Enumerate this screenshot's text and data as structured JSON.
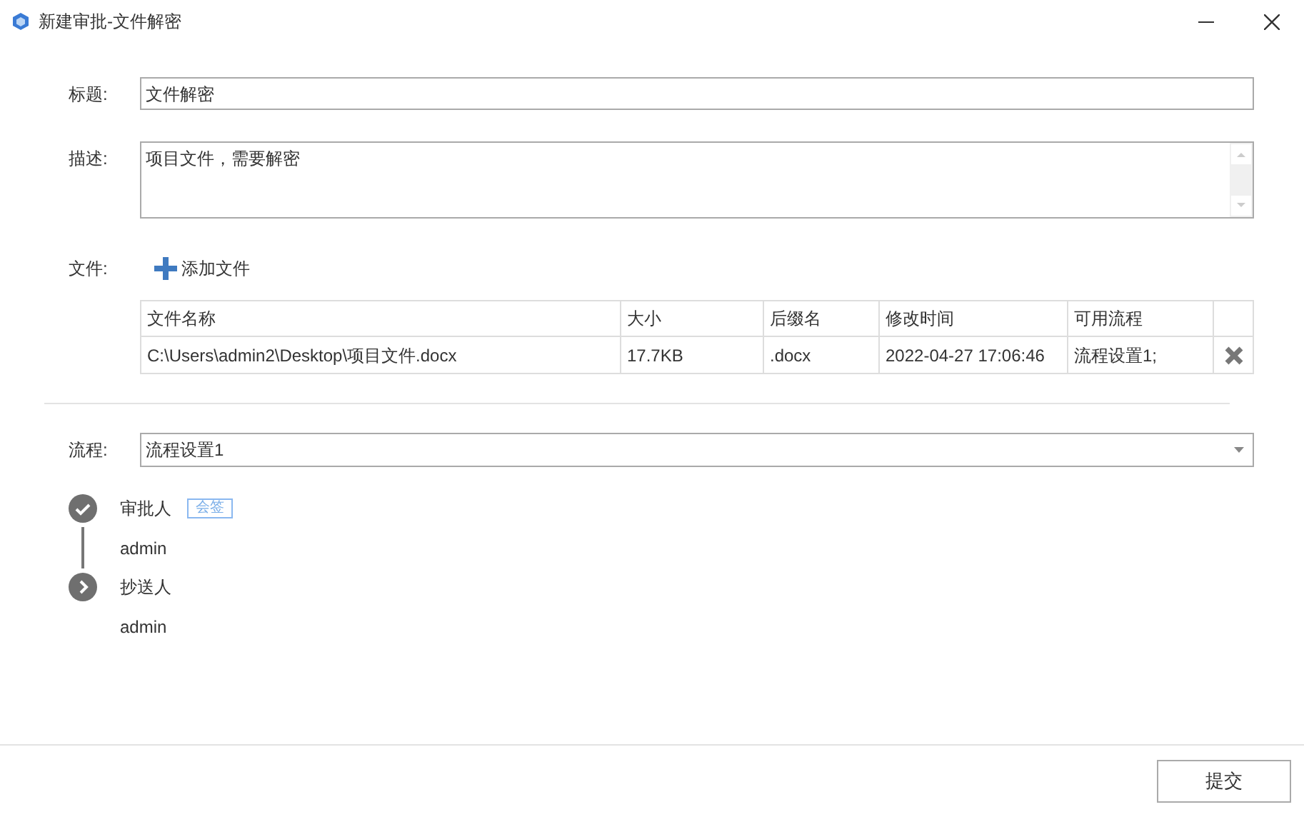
{
  "window": {
    "title": "新建审批-文件解密"
  },
  "form": {
    "title_label": "标题:",
    "title_value": "文件解密",
    "description_label": "描述:",
    "description_value": "项目文件，需要解密",
    "files_label": "文件:",
    "add_file": "添加文件"
  },
  "table": {
    "columns": [
      "文件名称",
      "大小",
      "后缀名",
      "修改时间",
      "可用流程"
    ],
    "rows": [
      {
        "cells": [
          "C:\\Users\\admin2\\Desktop\\项目文件.docx",
          "17.7KB",
          ".docx",
          "2022-04-27 17:06:46",
          "流程设置1;"
        ]
      }
    ]
  },
  "flow": {
    "label": "流程:",
    "value": "流程设置1"
  },
  "steps": [
    {
      "kind": "approver",
      "title": "审批人",
      "tag": "会签",
      "person": "admin"
    },
    {
      "kind": "cc",
      "title": "抄送人",
      "person": "admin"
    }
  ],
  "submit": "提交"
}
